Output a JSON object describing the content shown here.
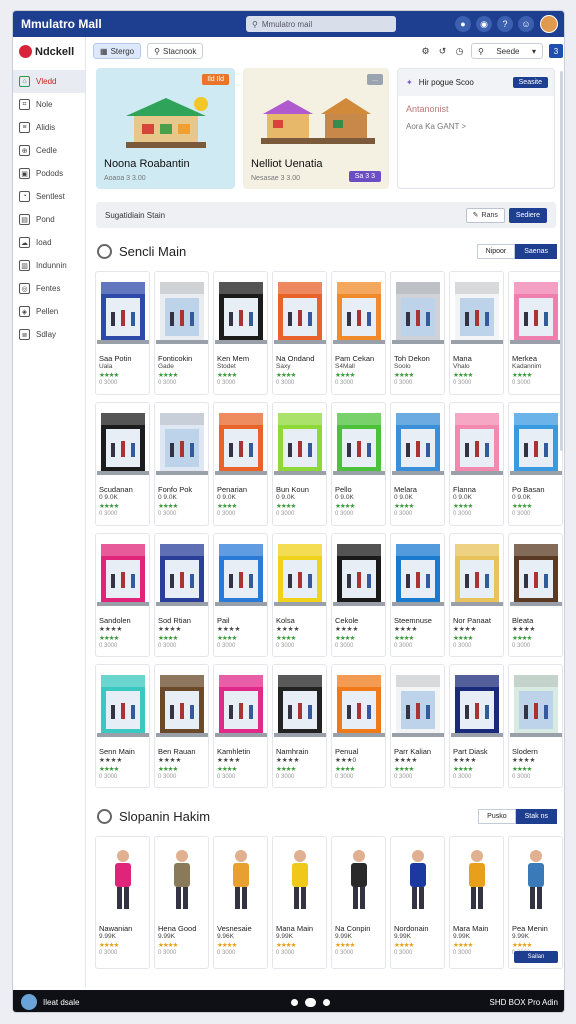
{
  "window": {
    "title": "Mmulatro Mall",
    "search_placeholder": "Mmulatro mail"
  },
  "sidebar": {
    "brand": "Ndckell",
    "items": [
      {
        "label": "Vledd",
        "icon": "home-icon",
        "active": true
      },
      {
        "label": "Nole",
        "icon": "tag-icon"
      },
      {
        "label": "Alidis",
        "icon": "list-icon"
      },
      {
        "label": "Cedle",
        "icon": "cart-icon"
      },
      {
        "label": "Podods",
        "icon": "box-icon"
      },
      {
        "label": "Sentlest",
        "icon": "bell-icon"
      },
      {
        "label": "Pond",
        "icon": "book-icon"
      },
      {
        "label": "Ioad",
        "icon": "cloud-icon"
      },
      {
        "label": "Indunnin",
        "icon": "chart-icon"
      },
      {
        "label": "Fentes",
        "icon": "globe-icon"
      },
      {
        "label": "Pellen",
        "icon": "car-icon"
      },
      {
        "label": "Sdlay",
        "icon": "layers-icon"
      }
    ]
  },
  "toolbar": {
    "tab1": "Stergo",
    "tab2": "Stacnook",
    "select": "Seede",
    "count": "3"
  },
  "banners": [
    {
      "tag": "Ild Ild",
      "title": "Noona Roabantin",
      "subtitle": "Aoaoa 3 3.00",
      "tag_color": "#e8752a"
    },
    {
      "tag": "...",
      "title": "Nelliot Uenatia",
      "subtitle": "Nesasae 3 3.00",
      "pill": "Sa 3 3",
      "tag_color": "#9aa3b0"
    },
    {
      "header": "Hir pogue Scoo",
      "header_btn": "Seasite",
      "line1": "Antanonist",
      "line2": "Aora Ka GANT >"
    }
  ],
  "filter": {
    "label": "Sugatidiain Stain",
    "btn1": "Rans",
    "btn2": "Sediere"
  },
  "section1": {
    "title": "Sencli Main",
    "toggle1": "Nipoor",
    "toggle2": "Saenas"
  },
  "stores": [
    {
      "name": "Saa Potin",
      "sub": "Uala",
      "color": "#2d4aa8",
      "stars": "★★★★",
      "meta": "0 3000"
    },
    {
      "name": "Fonticokin",
      "sub": "Gade",
      "color": "#e9ecf1",
      "stars": "★★★★",
      "meta": "0 3000"
    },
    {
      "name": "Ken Mem",
      "sub": "Stodet",
      "color": "#1b1b1b",
      "stars": "★★★★",
      "meta": "0 3000"
    },
    {
      "name": "Na Ondand",
      "sub": "Saxy",
      "color": "#e8622a",
      "stars": "★★★★",
      "meta": "0 3000"
    },
    {
      "name": "Pam Cekan",
      "sub": "S4Mall",
      "color": "#f08a2a",
      "stars": "★★★★",
      "meta": "0 3000"
    },
    {
      "name": "Toh Dekon",
      "sub": "Soolo",
      "color": "#cfd3d9",
      "stars": "★★★★",
      "meta": "0 3000"
    },
    {
      "name": "Mana",
      "sub": "Vhalo",
      "color": "#f3f4f6",
      "stars": "★★★★",
      "meta": "0 3000"
    },
    {
      "name": "Merkea",
      "sub": "Kadannim",
      "color": "#f07fb0",
      "stars": "★★★★",
      "meta": "0 3000"
    },
    {
      "name": "Scudanan",
      "sub": "0 9.0K",
      "color": "#1c1c1c",
      "stars": "★★★★",
      "meta": "0 3000"
    },
    {
      "name": "Fonfo Pok",
      "sub": "0 9.0K",
      "color": "#dfe7f3",
      "stars": "★★★★",
      "meta": "0 3000"
    },
    {
      "name": "Penarian",
      "sub": "0 9.0K",
      "color": "#e8642a",
      "stars": "★★★★",
      "meta": "0 3000"
    },
    {
      "name": "Bun Koun",
      "sub": "0 9.0K",
      "color": "#8fd83a",
      "stars": "★★★★",
      "meta": "0 3000"
    },
    {
      "name": "Pello",
      "sub": "0 9.0K",
      "color": "#4bc23a",
      "stars": "★★★★",
      "meta": "0 3000"
    },
    {
      "name": "Melara",
      "sub": "0 9.0K",
      "color": "#3a8fd8",
      "stars": "★★★★",
      "meta": "0 3000"
    },
    {
      "name": "Flanna",
      "sub": "0 9.0K",
      "color": "#f28ab0",
      "stars": "★★★★",
      "meta": "0 3000"
    },
    {
      "name": "Po Basan",
      "sub": "0 9.0K",
      "color": "#3a9ae0",
      "stars": "★★★★",
      "meta": "0 3000"
    },
    {
      "name": "Sandolen",
      "sub": "★★★★",
      "color": "#e0247a",
      "stars": "★★★★",
      "meta": "0 3000"
    },
    {
      "name": "Sod Rtian",
      "sub": "★★★★",
      "color": "#2a3f9a",
      "stars": "★★★★",
      "meta": "0 3000"
    },
    {
      "name": "Pail",
      "sub": "★★★★",
      "color": "#2a7bd8",
      "stars": "★★★★",
      "meta": "0 3000"
    },
    {
      "name": "Kolsa",
      "sub": "★★★★",
      "color": "#f0d21a",
      "stars": "★★★★",
      "meta": "0 3000"
    },
    {
      "name": "Cekole",
      "sub": "★★★★",
      "color": "#1a1a1a",
      "stars": "★★★★",
      "meta": "0 3000"
    },
    {
      "name": "Steemnuse",
      "sub": "★★★★",
      "color": "#1a7ad0",
      "stars": "★★★★",
      "meta": "0 3000"
    },
    {
      "name": "Nor Panaat",
      "sub": "★★★★",
      "color": "#e8c25a",
      "stars": "★★★★",
      "meta": "0 3000"
    },
    {
      "name": "Bleata",
      "sub": "★★★★",
      "color": "#5a3a22",
      "stars": "★★★★",
      "meta": "0 3000"
    },
    {
      "name": "Senn Main",
      "sub": "★★★★",
      "color": "#3ac8c0",
      "stars": "★★★★",
      "meta": "0 3000"
    },
    {
      "name": "Ben Rauan",
      "sub": "★★★★",
      "color": "#6a4a2a",
      "stars": "★★★★",
      "meta": "0 3000"
    },
    {
      "name": "Kamhletin",
      "sub": "★★★★",
      "color": "#e02a8a",
      "stars": "★★★★",
      "meta": "0 3000"
    },
    {
      "name": "Namhrain",
      "sub": "★★★★",
      "color": "#222222",
      "stars": "★★★★",
      "meta": "0 3000"
    },
    {
      "name": "Penual",
      "sub": "★★★0",
      "color": "#f07a1a",
      "stars": "★★★★",
      "meta": "0 3000"
    },
    {
      "name": "Parr Kalian",
      "sub": "★★★★",
      "color": "#f3f4f6",
      "stars": "★★★★",
      "meta": "0 3000"
    },
    {
      "name": "Part Diask",
      "sub": "★★★★",
      "color": "#1a2a7a",
      "stars": "★★★★",
      "meta": "0 3000"
    },
    {
      "name": "Slodern",
      "sub": "★★★★",
      "color": "#d8ebe3",
      "stars": "★★★★",
      "meta": "0 3000"
    }
  ],
  "section2": {
    "title": "Slopanin Hakim",
    "toggle1": "Pusko",
    "toggle2": "Stak ns"
  },
  "products": [
    {
      "name": "Nawanian",
      "sub": "9.99K",
      "color": "#e0247a",
      "stars": "★★★★",
      "meta": "0 3000"
    },
    {
      "name": "Hena Good",
      "sub": "9.99K",
      "color": "#8a7a5a",
      "stars": "★★★★",
      "meta": "0 3000"
    },
    {
      "name": "Vesnesaie",
      "sub": "9.96K",
      "color": "#e8a030",
      "stars": "★★★★",
      "meta": "0 3000"
    },
    {
      "name": "Mana Main",
      "sub": "9.99K",
      "color": "#f0c81a",
      "stars": "★★★★",
      "meta": "0 3000"
    },
    {
      "name": "Na Conpin",
      "sub": "9.99K",
      "color": "#2a2a2a",
      "stars": "★★★★",
      "meta": "0 3000"
    },
    {
      "name": "Nordonain",
      "sub": "9.99K",
      "color": "#1a3aa0",
      "stars": "★★★★",
      "meta": "0 3000"
    },
    {
      "name": "Mara Main",
      "sub": "9.99K",
      "color": "#e8a01a",
      "stars": "★★★★",
      "meta": "0 3000"
    },
    {
      "name": "Pea Menin",
      "sub": "9.99K",
      "color": "#3a7ab8",
      "stars": "★★★★",
      "meta": "0 3000",
      "button": "Sailan"
    }
  ],
  "footer": {
    "user": "Ileat dsale",
    "right": "SHD BOX Pro Adin"
  }
}
